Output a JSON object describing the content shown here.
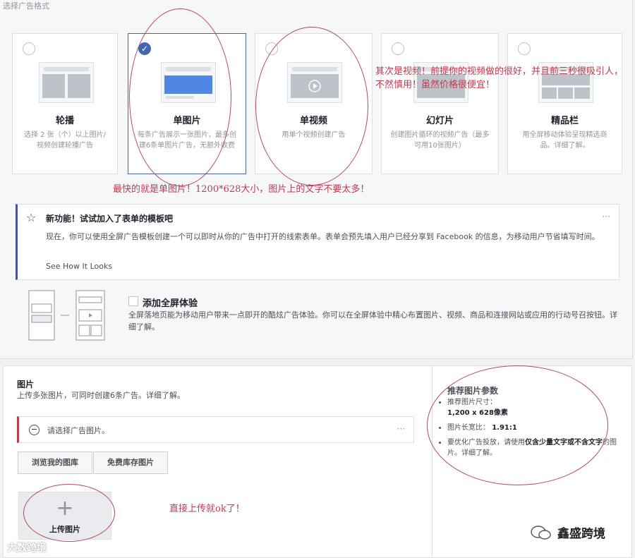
{
  "section_label": "选择广告格式",
  "formats": [
    {
      "name": "carousel",
      "title": "轮播",
      "desc": "选择 2 张（个）以上图片/视频创建轮播广告",
      "selected": false
    },
    {
      "name": "single-image",
      "title": "单图片",
      "desc": "每条广告展示一张图片，最多创建6条单图片广告，无额外收费",
      "selected": true
    },
    {
      "name": "single-video",
      "title": "单视频",
      "desc": "用单个视频创建广告",
      "selected": false
    },
    {
      "name": "slideshow",
      "title": "幻灯片",
      "desc": "创建图片循环的视频广告（最多可用10张图片）",
      "selected": false
    },
    {
      "name": "collection",
      "title": "精品栏",
      "desc": "用全屏移动体验呈现精选商品。详细了解。",
      "selected": false
    }
  ],
  "notes": {
    "video_note": "其次是视频！前提你的视频做的很好，并且前三秒很吸引人，不然慎用！虽然价格很便宜！",
    "image_note": "最快的就是单图片！1200*628大小，图片上的文字不要太多！",
    "upload_note": "直接上传就ok了！"
  },
  "notice": {
    "title": "新功能！试试加入了表单的模板吧",
    "body": "现在，你可以使用全屏广告模板创建一个可以即时从你的广告中打开的线索表单。表单会预先填入用户已经分享到 Facebook 的信息，为移动用户节省填写时间。",
    "link": "See How It Looks",
    "more": "···"
  },
  "fullscreen": {
    "title": "添加全屏体验",
    "desc": "全屏落地页能为移动用户带来一点即开的酷炫广告体验。你可以在全屏体验中精心布置图片、视频、商品和连接网站或应用的行动号召按钮。详细了解。"
  },
  "images_section": {
    "title": "图片",
    "subtitle": "上传多张图片，可同时创建6条广告。详细了解。",
    "alert": "请选择广告图片。",
    "alert_more": "···",
    "browse_library": "浏览我的图库",
    "free_stock": "免费库存图片",
    "upload_plus": "+",
    "upload_label": "上传图片"
  },
  "recommend": {
    "title": "推荐图片参数",
    "size_label": "推荐图片尺寸：",
    "size_value": "1,200 x 628像素",
    "ratio_label": "图片长宽比：",
    "ratio_value": "1.91:1",
    "text_tip_1": "要优化广告投放，请使用",
    "text_tip_bold": "仅含少量文字或不含文字",
    "text_tip_2": "的图片。详细了解。"
  },
  "watermarks": {
    "left": "大数跨境",
    "right": "鑫盛跨境"
  },
  "colors": {
    "accent": "#4267b2",
    "annotation_red": "#c0394d",
    "notice_border": "#4b4f9e"
  }
}
